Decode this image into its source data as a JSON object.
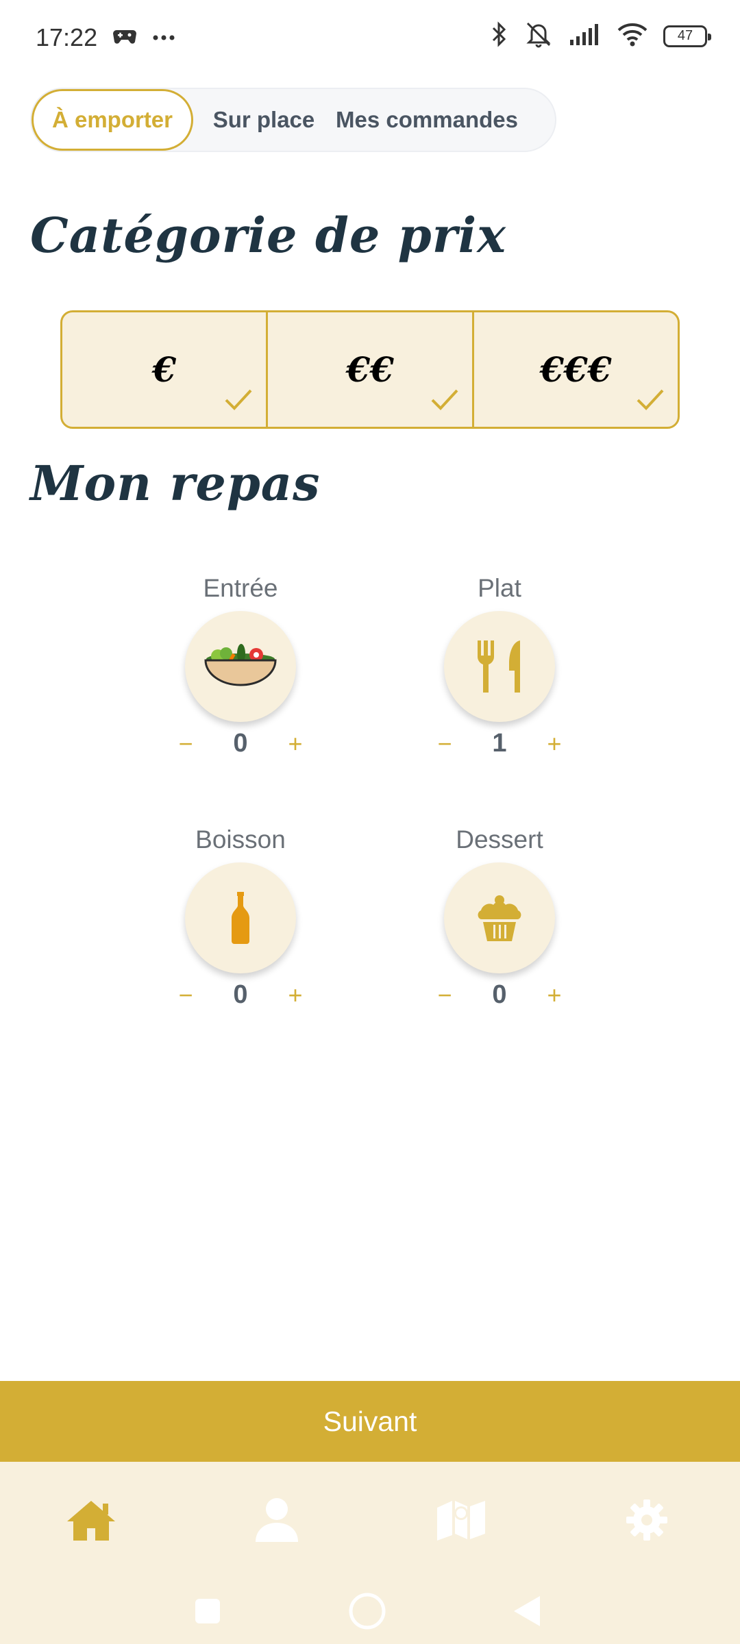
{
  "status_bar": {
    "time": "17:22",
    "battery": "47",
    "left_icons": [
      "game-controller-icon",
      "more-dots-icon"
    ],
    "right_icons": [
      "bluetooth-icon",
      "bell-off-icon",
      "signal-icon",
      "wifi-icon",
      "battery-icon"
    ]
  },
  "tabs": [
    {
      "label": "À emporter",
      "active": true
    },
    {
      "label": "Sur place",
      "active": false
    },
    {
      "label": "Mes commandes",
      "active": false
    }
  ],
  "price_section": {
    "title": "Catégorie de prix",
    "options": [
      {
        "label": "€",
        "selected": true
      },
      {
        "label": "€€",
        "selected": true
      },
      {
        "label": "€€€",
        "selected": true
      }
    ]
  },
  "meal_section": {
    "title": "Mon repas",
    "items": [
      {
        "label": "Entrée",
        "icon": "salad-bowl-icon",
        "count": "0",
        "minus": "−",
        "plus": "+"
      },
      {
        "label": "Plat",
        "icon": "fork-knife-icon",
        "count": "1",
        "minus": "−",
        "plus": "+"
      },
      {
        "label": "Boisson",
        "icon": "bottle-icon",
        "count": "0",
        "minus": "−",
        "plus": "+"
      },
      {
        "label": "Dessert",
        "icon": "cupcake-icon",
        "count": "0",
        "minus": "−",
        "plus": "+"
      }
    ]
  },
  "next_button": {
    "label": "Suivant"
  },
  "bottom_nav": {
    "items": [
      "home-icon",
      "user-icon",
      "map-icon",
      "gear-icon"
    ],
    "active": "home-icon"
  },
  "colors": {
    "accent": "#d3ae35",
    "cream": "#f8f0dd",
    "heading": "#1f3442",
    "inactive_icon": "#ffffff"
  }
}
